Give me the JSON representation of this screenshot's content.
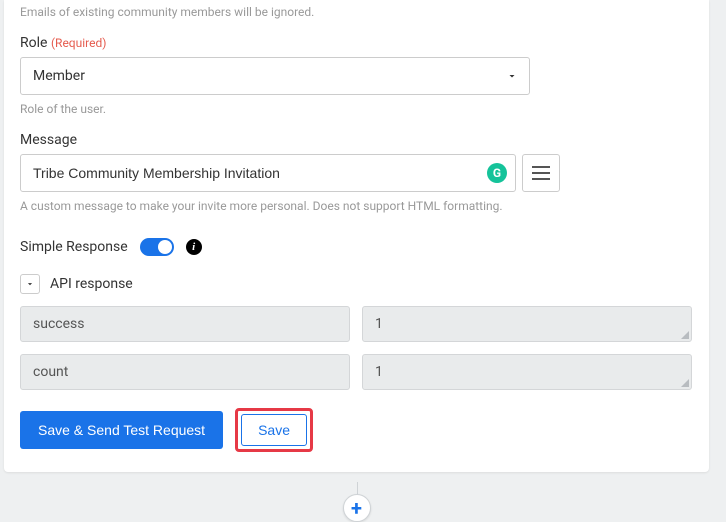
{
  "emails_helper": "Emails of existing community members will be ignored.",
  "role": {
    "label": "Role",
    "required": "(Required)",
    "value": "Member",
    "helper": "Role of the user."
  },
  "message": {
    "label": "Message",
    "value": "Tribe Community Membership Invitation",
    "helper": "A custom message to make your invite more personal. Does not support HTML formatting."
  },
  "simple_response_label": "Simple Response",
  "api_response_label": "API response",
  "kv": [
    {
      "key": "success",
      "val": "1"
    },
    {
      "key": "count",
      "val": "1"
    }
  ],
  "buttons": {
    "send_test": "Save & Send Test Request",
    "save": "Save"
  },
  "icons": {
    "grammarly": "G",
    "info": "i",
    "plus": "+"
  }
}
